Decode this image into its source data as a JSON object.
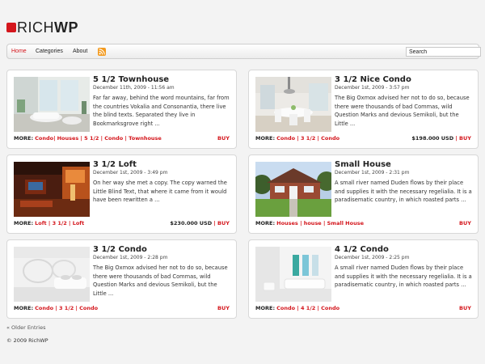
{
  "logo": {
    "part1": "RICH",
    "part2": "WP"
  },
  "nav": {
    "items": [
      "Home",
      "Categories",
      "About"
    ],
    "search_placeholder": "Search"
  },
  "cards": [
    {
      "title": "5 1/2 Townhouse",
      "date": "December 11th, 2009 - 11:56 am",
      "excerpt": "Far far away, behind the word mountains, far from the countries Vokalia and Consonantia, there live the blind texts. Separated they live in Bookmarksgrove right ...",
      "more_label": "MORE:",
      "tags": [
        "Condo",
        "Houses",
        "5 1/2",
        "Condo",
        "Townhouse"
      ],
      "price": "",
      "buy": "BUY"
    },
    {
      "title": "3 1/2 Nice Condo",
      "date": "December 1st, 2009 - 3:57 pm",
      "excerpt": "The Big Oxmox advised her not to do so, because there were thousands of bad Commas, wild Question Marks and devious Semikoli, but the Little ...",
      "more_label": "MORE:",
      "tags": [
        "Condo",
        "3 1/2",
        "Condo"
      ],
      "price": "$198.000 USD",
      "buy": "BUY"
    },
    {
      "title": "3 1/2 Loft",
      "date": "December 1st, 2009 - 3:49 pm",
      "excerpt": "On her way she met a copy. The copy warned the Little Blind Text, that where it came from it would have been rewritten a ...",
      "more_label": "MORE:",
      "tags": [
        "Loft",
        "3 1/2",
        "Loft"
      ],
      "price": "$230.000 USD",
      "buy": "BUY"
    },
    {
      "title": "Small House",
      "date": "December 1st, 2009 - 2:31 pm",
      "excerpt": "A small river named Duden flows by their place and supplies it with the necessary regelialia. It is a paradisematic country, in which roasted parts ...",
      "more_label": "MORE:",
      "tags": [
        "Houses",
        "house",
        "Small House"
      ],
      "price": "",
      "buy": "BUY"
    },
    {
      "title": "3 1/2 Condo",
      "date": "December 1st, 2009 - 2:28 pm",
      "excerpt": "The Big Oxmox advised her not to do so, because there were thousands of bad Commas, wild Question Marks and devious Semikoli, but the Little ...",
      "more_label": "MORE:",
      "tags": [
        "Condo",
        "3 1/2",
        "Condo"
      ],
      "price": "",
      "buy": "BUY"
    },
    {
      "title": "4 1/2 Condo",
      "date": "December 1st, 2009 - 2:25 pm",
      "excerpt": "A small river named Duden flows by their place and supplies it with the necessary regelialia. It is a paradisematic country, in which roasted parts ...",
      "more_label": "MORE:",
      "tags": [
        "Condo",
        "4 1/2",
        "Condo"
      ],
      "price": "",
      "buy": "BUY"
    }
  ],
  "pagination": {
    "older": "« Older Entries"
  },
  "footer": {
    "copyright": "© 2009 RichWP"
  }
}
